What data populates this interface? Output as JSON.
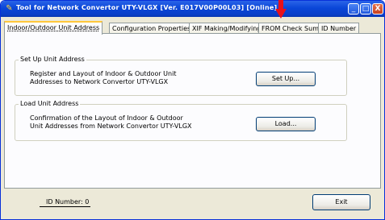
{
  "window": {
    "title": "Tool for Network Convertor UTY-VLGX [Ver. E017V00P00L03] [Online]",
    "controls": {
      "minimize": "_",
      "maximize": "□",
      "close": "X"
    }
  },
  "tabs": [
    {
      "label": "Indoor/Outdoor Unit Address",
      "active": true
    },
    {
      "label": "Configuration Properties",
      "active": false
    },
    {
      "label": "XIF Making/Modifying",
      "active": false
    },
    {
      "label": "FROM Check Sum",
      "active": false
    },
    {
      "label": "ID Number",
      "active": false
    }
  ],
  "groups": {
    "setup": {
      "legend": "Set Up Unit Address",
      "description_line1": "Register and Layout of Indoor & Outdoor Unit",
      "description_line2": "Addresses to Network Convertor UTY-VLGX",
      "button": "Set Up..."
    },
    "load": {
      "legend": "Load Unit Address",
      "description_line1": "Confirmation of the Layout of Indoor & Outdoor",
      "description_line2": "Unit Addresses from Network Convertor UTY-VLGX",
      "button": "Load..."
    }
  },
  "status": {
    "id_number": "ID Number:  0"
  },
  "footer": {
    "exit_label": "Exit"
  },
  "colors": {
    "titlebar": "#0a46d8",
    "window_bg": "#ece9d8",
    "annotation_arrow": "#e8101a"
  }
}
